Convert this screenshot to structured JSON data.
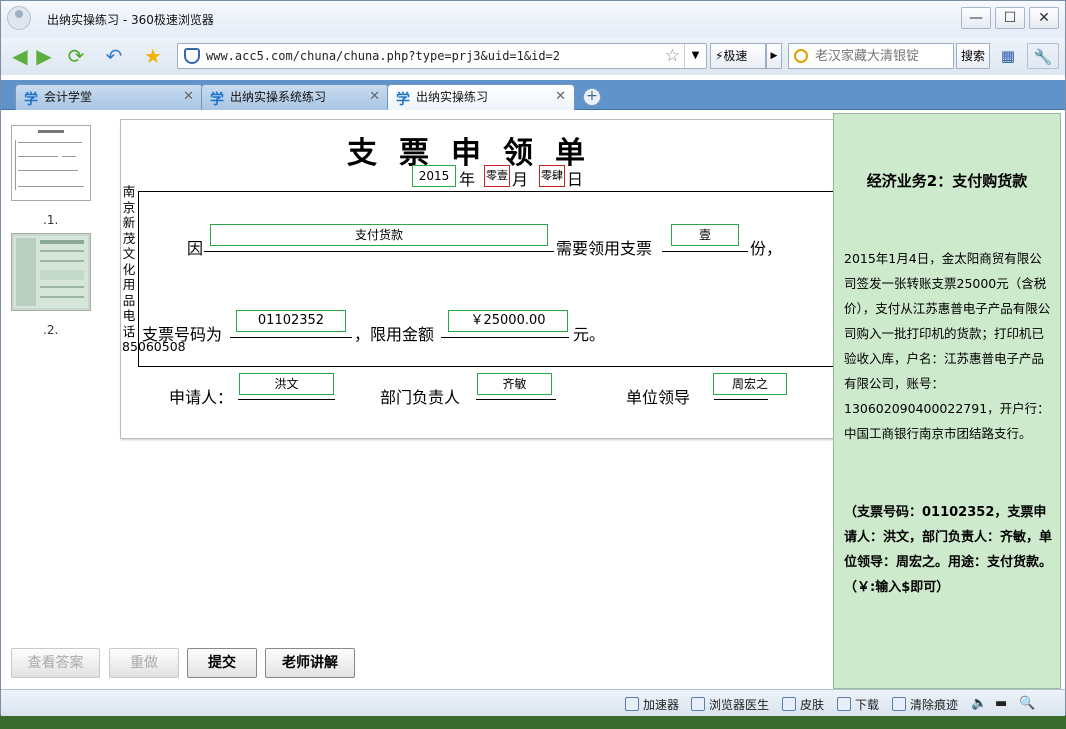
{
  "window": {
    "title": "出纳实操练习 - 360极速浏览器",
    "controls": [
      "—",
      "☐",
      "✕"
    ]
  },
  "toolbar": {
    "url": "www.acc5.com/chuna/chuna.php?type=prj3&uid=1&id=2",
    "speed_label": "⚡极速",
    "search_placeholder": "老汉家藏大清银锭",
    "search_button": "搜索"
  },
  "tabs": [
    {
      "label": "会计学堂",
      "active": false
    },
    {
      "label": "出纳实操系统练习",
      "active": false
    },
    {
      "label": "出纳实操练习",
      "active": true
    }
  ],
  "thumbnails": [
    {
      "label": ".1."
    },
    {
      "label": ".2."
    }
  ],
  "form": {
    "title": "支票申领单",
    "year": "2015",
    "year_suffix": "年",
    "month": "零壹",
    "month_suffix": "月",
    "day": "零肆",
    "day_suffix": "日",
    "side_text": "南京新茂文化用品电话85060508",
    "reason_prefix": "因",
    "reason": "支付货款",
    "need_label": "需要领用支票",
    "quantity": "壹",
    "quantity_suffix": "份，",
    "check_no_label": "支票号码为",
    "check_no": "01102352",
    "limit_label": "，限用金额",
    "amount": "￥25000.00",
    "amount_suffix": "元。",
    "applicant_label": "申请人：",
    "applicant": "洪文",
    "dept_head_label": "部门负责人",
    "dept_head": "齐敏",
    "leader_label": "单位领导",
    "leader": "周宏之"
  },
  "panel": {
    "title": "经济业务2：支付购货款",
    "body": "2015年1月4日，金太阳商贸有限公司签发一张转账支票25000元（含税价），支付从江苏惠普电子产品有限公司购入一批打印机的货款；打印机已验收入库，户名：江苏惠普电子产品有限公司，账号：130602090400022791，开户行：中国工商银行南京市团结路支行。",
    "note": "（支票号码：01102352，支票申请人：洪文，部门负责人：齐敏，单位领导：周宏之。用途：支付货款。（￥:输入$即可）"
  },
  "buttons": {
    "view_answer": "查看答案",
    "redo": "重做",
    "submit": "提交",
    "teacher": "老师讲解"
  },
  "statusbar": {
    "accelerator": "加速器",
    "doctor": "浏览器医生",
    "skin": "皮肤",
    "download": "下载",
    "clear": "清除痕迹"
  }
}
